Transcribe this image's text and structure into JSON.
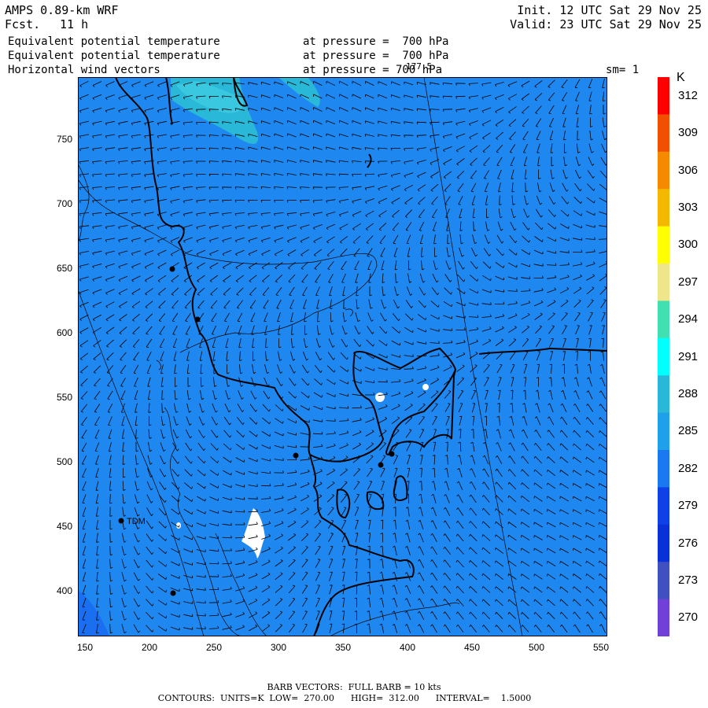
{
  "header": {
    "model": "AMPS 0.89-km WRF",
    "forecast_label": "Fcst.",
    "forecast_value": "11 h",
    "init": "Init. 12 UTC Sat 29 Nov 25",
    "valid": "Valid: 23 UTC Sat 29 Nov 25",
    "fields": [
      {
        "name": "Equivalent potential temperature",
        "pressure": "at pressure =  700 hPa"
      },
      {
        "name": "Equivalent potential temperature",
        "pressure": "at pressure =  700 hPa"
      },
      {
        "name": "Horizontal wind vectors",
        "pressure": "at pressure = 700 hPa"
      }
    ],
    "sm": "sm= 1",
    "contour_label": "177.5"
  },
  "axes": {
    "x_ticks": [
      "150",
      "200",
      "250",
      "300",
      "350",
      "400",
      "450",
      "500",
      "550"
    ],
    "y_ticks": [
      "750",
      "700",
      "650",
      "600",
      "550",
      "500",
      "450",
      "400"
    ]
  },
  "colorbar": {
    "unit": "K",
    "labels": [
      "312",
      "309",
      "306",
      "303",
      "300",
      "297",
      "294",
      "291",
      "288",
      "285",
      "282",
      "279",
      "276",
      "273",
      "270"
    ],
    "colors": [
      "#ff0000",
      "#f05000",
      "#f58a00",
      "#f5b800",
      "#ffff00",
      "#efe68a",
      "#40e0b0",
      "#00ffff",
      "#2ab8d8",
      "#1fa0e8",
      "#1a78f0",
      "#1040e8",
      "#0a30d8",
      "#4050c0",
      "#7040d8"
    ]
  },
  "map": {
    "background": "#1e88f0",
    "station_label": "TDM",
    "colors": {
      "warm_patch": "#2ab8d8",
      "cool_patch": "#1a6ef0",
      "missing": "#ffffff"
    }
  },
  "footer": {
    "barbs": "BARB VECTORS:  FULL BARB = 10 kts",
    "contours": "CONTOURS:  UNITS=K  LOW=  270.00      HIGH=  312.00      INTERVAL=    1.5000"
  }
}
